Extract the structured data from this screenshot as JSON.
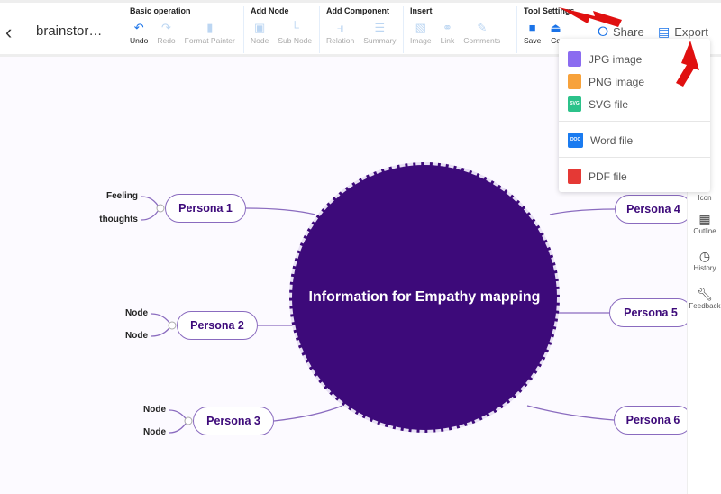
{
  "header": {
    "back_icon": "chevron-left-icon",
    "title": "brainstor…",
    "share": "Share",
    "export": "Export"
  },
  "groups": [
    {
      "title": "Basic operation",
      "tools": [
        "Undo",
        "Redo",
        "Format Painter"
      ]
    },
    {
      "title": "Add Node",
      "tools": [
        "Node",
        "Sub Node"
      ]
    },
    {
      "title": "Add Component",
      "tools": [
        "Relation",
        "Summary"
      ]
    },
    {
      "title": "Insert",
      "tools": [
        "Image",
        "Link",
        "Comments"
      ]
    },
    {
      "title": "Tool Settings",
      "tools": [
        "Save",
        "Co"
      ]
    }
  ],
  "export_menu": [
    "JPG image",
    "PNG image",
    "SVG file",
    "Word file",
    "PDF file"
  ],
  "file_badges": [
    "SVG",
    "DOC"
  ],
  "sidebar": [
    "Icon",
    "Outline",
    "History",
    "Feedback"
  ],
  "mindmap": {
    "center": "Information for Empathy mapping",
    "personas": [
      "Persona 1",
      "Persona 2",
      "Persona 3",
      "Persona 4",
      "Persona 5",
      "Persona 6"
    ],
    "subs": [
      "Feeling",
      "thoughts",
      "Node",
      "Node",
      "Node",
      "Node"
    ]
  },
  "colors": {
    "center": "#3d0a7a",
    "accent": "#1a73e8",
    "arrow": "#e01010"
  }
}
